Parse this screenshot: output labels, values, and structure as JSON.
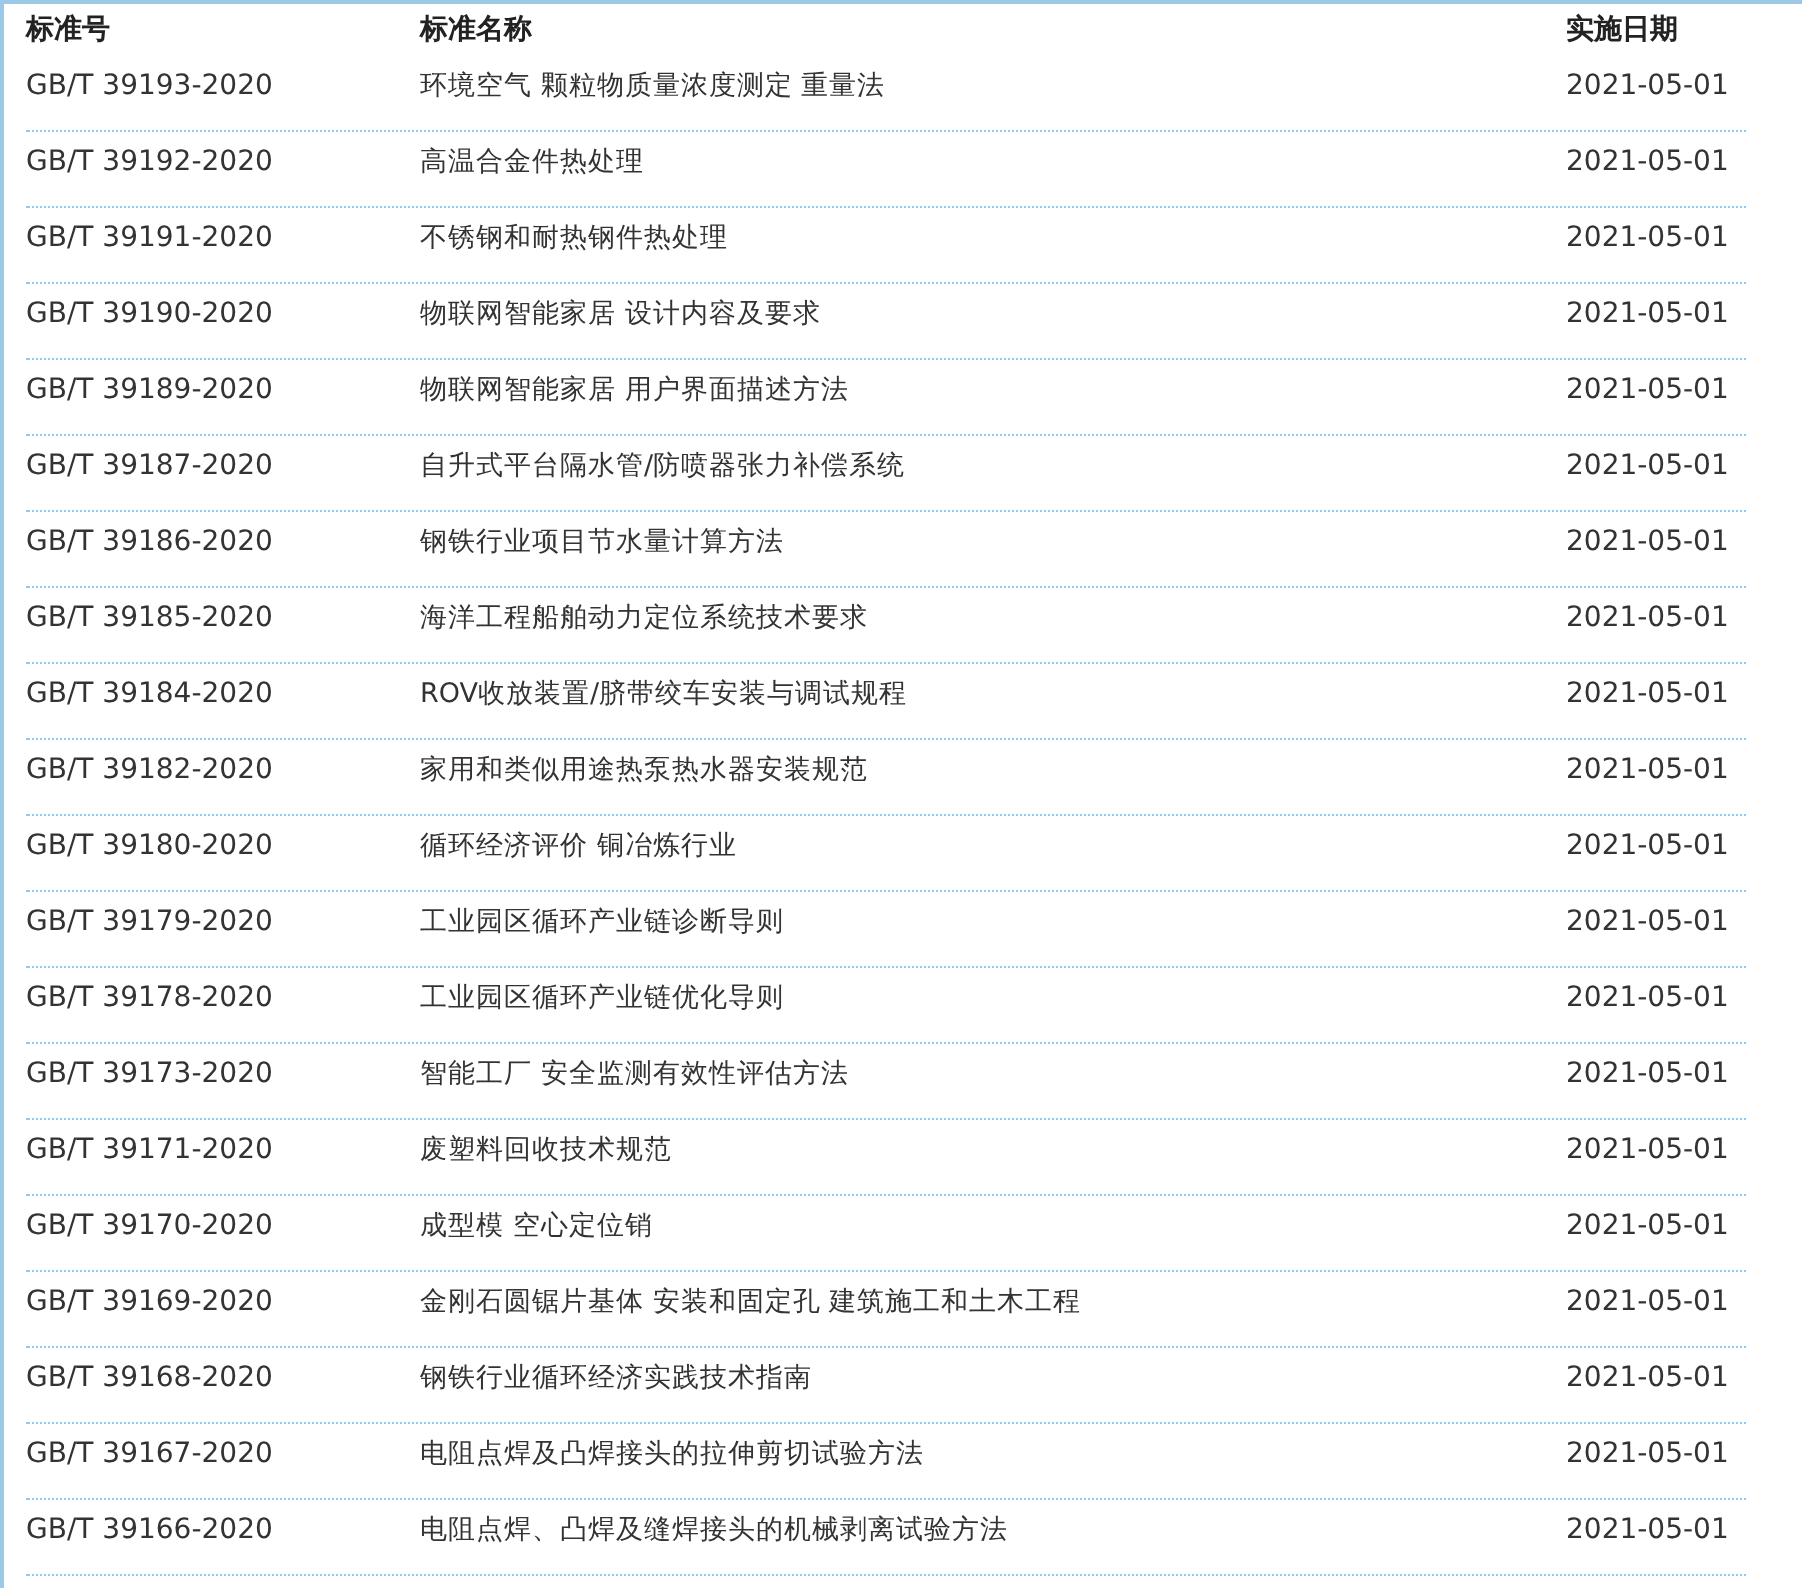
{
  "table": {
    "columns": [
      "标准号",
      "标准名称",
      "实施日期"
    ],
    "rows": [
      {
        "code": "GB/T 39193-2020",
        "name": "环境空气 颗粒物质量浓度测定 重量法",
        "date": "2021-05-01"
      },
      {
        "code": "GB/T 39192-2020",
        "name": "高温合金件热处理",
        "date": "2021-05-01"
      },
      {
        "code": "GB/T 39191-2020",
        "name": "不锈钢和耐热钢件热处理",
        "date": "2021-05-01"
      },
      {
        "code": "GB/T 39190-2020",
        "name": "物联网智能家居 设计内容及要求",
        "date": "2021-05-01"
      },
      {
        "code": "GB/T 39189-2020",
        "name": "物联网智能家居 用户界面描述方法",
        "date": "2021-05-01"
      },
      {
        "code": "GB/T 39187-2020",
        "name": "自升式平台隔水管/防喷器张力补偿系统",
        "date": "2021-05-01"
      },
      {
        "code": "GB/T 39186-2020",
        "name": "钢铁行业项目节水量计算方法",
        "date": "2021-05-01"
      },
      {
        "code": "GB/T 39185-2020",
        "name": "海洋工程船舶动力定位系统技术要求",
        "date": "2021-05-01"
      },
      {
        "code": "GB/T 39184-2020",
        "name": "ROV收放装置/脐带绞车安装与调试规程",
        "date": "2021-05-01"
      },
      {
        "code": "GB/T 39182-2020",
        "name": "家用和类似用途热泵热水器安装规范",
        "date": "2021-05-01"
      },
      {
        "code": "GB/T 39180-2020",
        "name": "循环经济评价 铜冶炼行业",
        "date": "2021-05-01"
      },
      {
        "code": "GB/T 39179-2020",
        "name": "工业园区循环产业链诊断导则",
        "date": "2021-05-01"
      },
      {
        "code": "GB/T 39178-2020",
        "name": "工业园区循环产业链优化导则",
        "date": "2021-05-01"
      },
      {
        "code": "GB/T 39173-2020",
        "name": "智能工厂 安全监测有效性评估方法",
        "date": "2021-05-01"
      },
      {
        "code": "GB/T 39171-2020",
        "name": "废塑料回收技术规范",
        "date": "2021-05-01"
      },
      {
        "code": "GB/T 39170-2020",
        "name": "成型模 空心定位销",
        "date": "2021-05-01"
      },
      {
        "code": "GB/T 39169-2020",
        "name": "金刚石圆锯片基体 安装和固定孔 建筑施工和土木工程",
        "date": "2021-05-01"
      },
      {
        "code": "GB/T 39168-2020",
        "name": "钢铁行业循环经济实践技术指南",
        "date": "2021-05-01"
      },
      {
        "code": "GB/T 39167-2020",
        "name": "电阻点焊及凸焊接头的拉伸剪切试验方法",
        "date": "2021-05-01"
      },
      {
        "code": "GB/T 39166-2020",
        "name": "电阻点焊、凸焊及缝焊接头的机械剥离试验方法",
        "date": "2021-05-01"
      }
    ]
  }
}
